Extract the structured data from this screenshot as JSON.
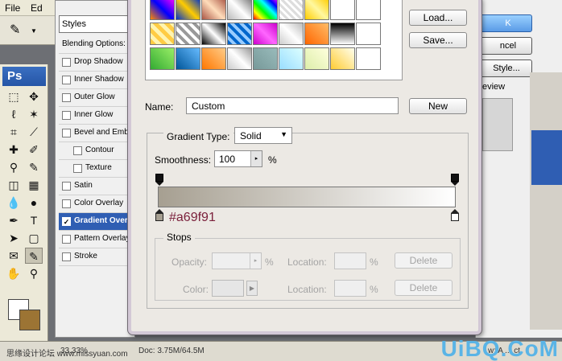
{
  "menubar": {
    "items": [
      "File",
      "Ed"
    ]
  },
  "layer_style": {
    "header": "Styles",
    "blending": "Blending Options:",
    "items": [
      {
        "label": "Drop Shadow",
        "checked": false,
        "indent": false
      },
      {
        "label": "Inner Shadow",
        "checked": false,
        "indent": false
      },
      {
        "label": "Outer Glow",
        "checked": false,
        "indent": false
      },
      {
        "label": "Inner Glow",
        "checked": false,
        "indent": false
      },
      {
        "label": "Bevel and Embo",
        "checked": false,
        "indent": false
      },
      {
        "label": "Contour",
        "checked": false,
        "indent": true
      },
      {
        "label": "Texture",
        "checked": false,
        "indent": true
      },
      {
        "label": "Satin",
        "checked": false,
        "indent": false
      },
      {
        "label": "Color Overlay",
        "checked": false,
        "indent": false
      },
      {
        "label": "Gradient Overl",
        "checked": true,
        "indent": false,
        "selected": true
      },
      {
        "label": "Pattern Overlay",
        "checked": false,
        "indent": false
      },
      {
        "label": "Stroke",
        "checked": false,
        "indent": false
      }
    ],
    "check_mark": "✓"
  },
  "right_pane": {
    "ok": "K",
    "cancel": "ncel",
    "style": "Style...",
    "preview": "eview"
  },
  "toolbox": {
    "app_label": "Ps"
  },
  "gradient_editor": {
    "load_label": "Load...",
    "save_label": "Save...",
    "name_label": "Name:",
    "name_value": "Custom",
    "new_label": "New",
    "gradient_type_label": "Gradient Type:",
    "gradient_type_value": "Solid",
    "smoothness_label": "Smoothness:",
    "smoothness_value": "100",
    "smoothness_unit": "%",
    "stop_color_hex": "#a69f91",
    "stops": {
      "title": "Stops",
      "opacity_label": "Opacity:",
      "opacity_unit": "%",
      "location_label": "Location:",
      "location_unit": "%",
      "delete_label": "Delete",
      "color_label": "Color:"
    },
    "gradient_colors": {
      "start": "#a69f91",
      "end": "#ffffff"
    }
  },
  "statusbar": {
    "zoom": "33.33%",
    "doc": "Doc: 3.75M/64.5M",
    "right": "w: A ... ct",
    "left_watermark": "思缘设计论坛 www.missyuan.com"
  },
  "watermark": "UiBQ.CoM"
}
